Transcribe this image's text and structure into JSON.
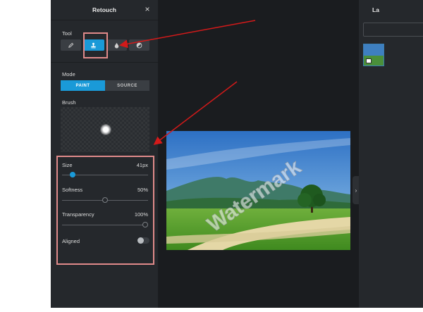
{
  "panel": {
    "title": "Retouch",
    "close_icon": "×",
    "tool_label": "Tool",
    "tools": [
      {
        "name": "pencil",
        "icon": "pencil-icon"
      },
      {
        "name": "clone-stamp",
        "icon": "stamp-icon",
        "active": true
      },
      {
        "name": "blur",
        "icon": "drop-icon"
      },
      {
        "name": "dodge",
        "icon": "contrast-icon"
      }
    ],
    "mode_label": "Mode",
    "modes": {
      "paint": "PAINT",
      "source": "SOURCE",
      "active": "paint"
    },
    "brush_label": "Brush",
    "sliders": {
      "size": {
        "label": "Size",
        "value": "41px",
        "fraction": 0.1
      },
      "softness": {
        "label": "Softness",
        "value": "50%",
        "fraction": 0.5
      },
      "transparency": {
        "label": "Transparency",
        "value": "100%",
        "fraction": 1.0
      }
    },
    "aligned": {
      "label": "Aligned",
      "on": false
    }
  },
  "canvas": {
    "watermark_text": "Watermark"
  },
  "layers": {
    "title": "La",
    "collapse_icon": "›"
  },
  "colors": {
    "accent": "#1a9ad8",
    "panel_bg": "#25282c",
    "app_bg": "#1a1c1f",
    "annotation": "#d31a1a",
    "annotation_box": "#e08a8a"
  }
}
